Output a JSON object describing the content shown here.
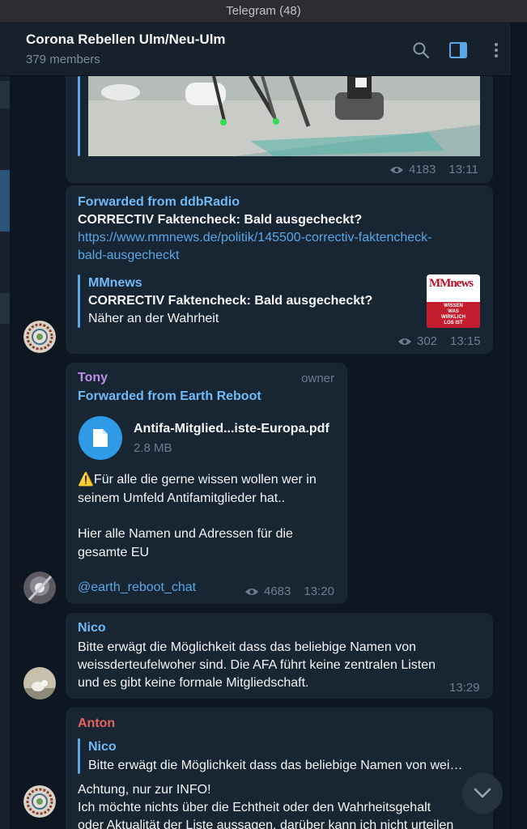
{
  "window": {
    "title": "Telegram (48)"
  },
  "header": {
    "chat_title": "Corona Rebellen Ulm/Neu-Ulm",
    "members": "379 members"
  },
  "icons": {
    "search": "search-icon",
    "panel": "side-panel-icon",
    "more": "more-vertical-icon",
    "eye": "eye-icon",
    "file": "file-icon",
    "scroll": "chevron-down-icon"
  },
  "colors": {
    "background": "#0e1621",
    "bubble": "#182533",
    "accent": "#5aa7e6",
    "tony": "#c08de8",
    "anton": "#e8625c"
  },
  "messages": [
    {
      "id": "video",
      "views": "4183",
      "time": "13:11"
    },
    {
      "id": "mmnews",
      "forwarded": "Forwarded from ddbRadio",
      "text": "CORRECTIV Faktencheck: Bald ausgecheckt?",
      "link_line1": "https://www.mmnews.de/politik/145500-correctiv-faktencheck-",
      "link_line2": "bald-ausgecheckt",
      "preview": {
        "site": "MMnews",
        "title": "CORRECTIV Faktencheck: Bald ausgecheckt?",
        "desc": "Näher an der Wahrheit",
        "thumb_logo": "MMnews",
        "thumb_line1": "WISSEN",
        "thumb_line2": "WAS",
        "thumb_line3": "WIRKLICH",
        "thumb_line4": "LOS IST"
      },
      "views": "302",
      "time": "13:15"
    },
    {
      "id": "tony",
      "sender": "Tony",
      "badge": "owner",
      "forwarded": "Forwarded from Earth Reboot",
      "file_name": "Antifa-Mitglied...iste-Europa.pdf",
      "file_size": "2.8 MB",
      "warn": "⚠️",
      "line1": "Für alle die gerne wissen wollen wer in",
      "line2": "seinem Umfeld Antifamitglieder hat..",
      "line3": "Hier alle Namen und Adressen für die",
      "line4": "gesamte EU",
      "mention": "@earth_reboot_chat",
      "views": "4683",
      "time": "13:20"
    },
    {
      "id": "nico",
      "sender": "Nico",
      "line1": "Bitte erwägt die Möglichkeit dass das beliebige Namen von",
      "line2": "weissderteufelwoher sind. Die AFA führt keine zentralen Listen",
      "line3": "und es gibt keine formale Mitgliedschaft.",
      "time": "13:29"
    },
    {
      "id": "anton",
      "sender": "Anton",
      "reply_name": "Nico",
      "reply_text": "Bitte erwägt die Möglichkeit dass das beliebige Namen von wei…",
      "line1": "Achtung, nur zur INFO!",
      "line2": "Ich möchte nichts über die Echtheit oder den Wahrheitsgehalt",
      "line3": "oder Aktualität der Liste aussagen, darüber kann ich nicht urteilen"
    }
  ]
}
